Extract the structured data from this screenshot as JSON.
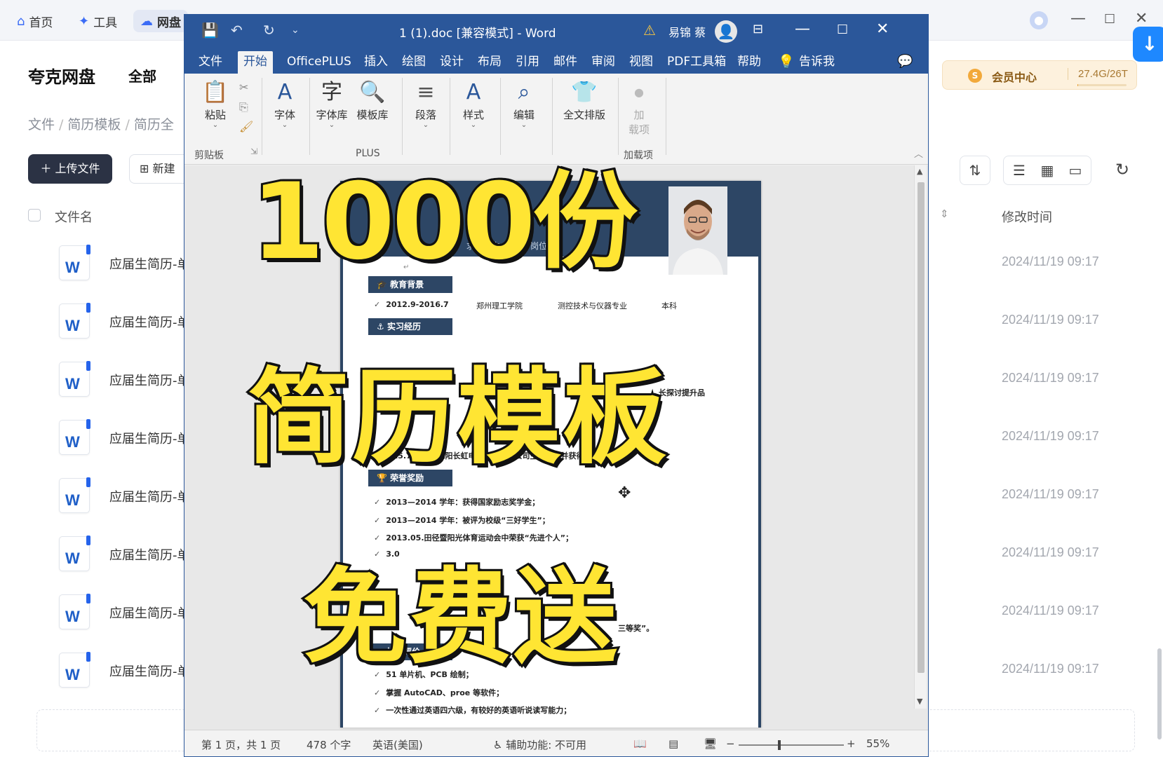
{
  "top_nav": {
    "home": "首页",
    "tools": "工具",
    "drive": "网盘"
  },
  "drive": {
    "brand": "夸克网盘",
    "scope": "全部",
    "breadcrumb": [
      "文件",
      "简历模板",
      "简历全"
    ],
    "upload_label": "上传文件",
    "new_label": "新建",
    "col_name": "文件名",
    "col_mtime": "修改时间",
    "member": {
      "label": "会员中心",
      "storage": "27.4G/26T",
      "usage_fraction": 0.01
    },
    "files": [
      {
        "name": "应届生简历-单",
        "time": "2024/11/19 09:17"
      },
      {
        "name": "应届生简历-单",
        "time": "2024/11/19 09:17"
      },
      {
        "name": "应届生简历-单",
        "time": "2024/11/19 09:17"
      },
      {
        "name": "应届生简历-单",
        "time": "2024/11/19 09:17"
      },
      {
        "name": "应届生简历-单",
        "time": "2024/11/19 09:17"
      },
      {
        "name": "应届生简历-单",
        "time": "2024/11/19 09:17"
      },
      {
        "name": "应届生简历-单",
        "time": "2024/11/19 09:17"
      },
      {
        "name": "应届生简历-单",
        "time": "2024/11/19 09:17"
      }
    ]
  },
  "word": {
    "title": "1 (1).doc [兼容模式] - Word",
    "user": "易锦 蔡",
    "tabs": [
      "文件",
      "开始",
      "OfficePLUS",
      "插入",
      "绘图",
      "设计",
      "布局",
      "引用",
      "邮件",
      "审阅",
      "视图",
      "PDF工具箱",
      "帮助",
      "告诉我"
    ],
    "active_tab": "开始",
    "ribbon": {
      "paste": "粘贴",
      "clipboard": "剪贴板",
      "font": "字体",
      "font_lib": "字体库",
      "template_lib": "模板库",
      "plus_group": "PLUS",
      "paragraph": "段落",
      "styles": "样式",
      "editing": "编辑",
      "full_layout": "全文排版",
      "addin_top": "加",
      "addin_bottom": "载项",
      "addins_group": "加载项"
    },
    "document": {
      "header_text": "求职意向：机 ... 岗位",
      "sections": {
        "education": "教育背景",
        "internship": "实习经历",
        "honors": "荣誉奖励",
        "skills": "技能评价"
      },
      "education_row": [
        "2012.9-2016.7",
        "郑州理工学院",
        "测控技术与仪器专业",
        "本科"
      ],
      "internship_fragment": "长探讨提升品",
      "internship_line": "2015.7 在四川绵阳长虹电器股份有限公司生产实习并获得优秀成绩。",
      "honors": [
        "2013—2014 学年：获得国家励志奖学金；",
        "2013—2014 学年：被评为校级“三好学生”；",
        "2013.05.田径暨阳光体育运动会中荣获“先进个人”；"
      ],
      "honors_fragment": "3.0",
      "honors_tail": "三等奖”。",
      "skills": [
        "51 单片机、PCB 绘制；",
        "掌握 AutoCAD、proe 等软件；",
        "一次性通过英语四六级，有较好的英语听说读写能力；"
      ]
    },
    "status": {
      "page": "第 1 页，共 1 页",
      "words": "478 个字",
      "lang": "英语(美国)",
      "accessibility": "辅助功能: 不可用",
      "zoom": "55%"
    }
  },
  "overlay": {
    "line1": "1000份",
    "line2": "简历模板",
    "line3": "免费送"
  },
  "colors": {
    "word_blue": "#2b579a",
    "overlay_yellow": "#ffe533",
    "doc_navy": "#2d4665",
    "drive_accent": "#1e88ff"
  }
}
